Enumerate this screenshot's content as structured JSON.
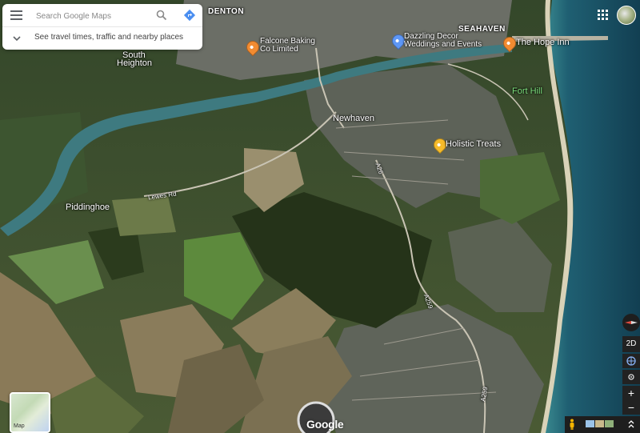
{
  "search": {
    "placeholder": "Search Google Maps",
    "hint": "See travel times, traffic and nearby places"
  },
  "places": {
    "denton": "DENTON",
    "seahaven": "SEAHAVEN",
    "south_heighton_1": "South",
    "south_heighton_2": "Heighton",
    "newhaven": "Newhaven",
    "piddinghoe": "Piddinghoe",
    "fort_hill": "Fort Hill"
  },
  "pois": {
    "falcone_1": "Falcone Baking",
    "falcone_2": "Co Limited",
    "dazzling_1": "Dazzling Decor",
    "dazzling_2": "Weddings and Events",
    "hope_inn": "The Hope Inn",
    "holistic": "Holistic Treats"
  },
  "roads": {
    "a26": "A26",
    "a259_a": "A259",
    "a259_b": "A259",
    "lewes_rd": "Lewes Rd"
  },
  "controls": {
    "view_2d": "2D",
    "zoom_in": "+",
    "zoom_out": "−",
    "minimap_label": "Map",
    "brand": "Google"
  },
  "colors": {
    "food_pin": "#f28b31",
    "shopping_pin": "#5e97f6",
    "restaurant_pin": "#f28b31",
    "place_pin": "#f6bb2a",
    "sea": "#1f5b6e"
  }
}
